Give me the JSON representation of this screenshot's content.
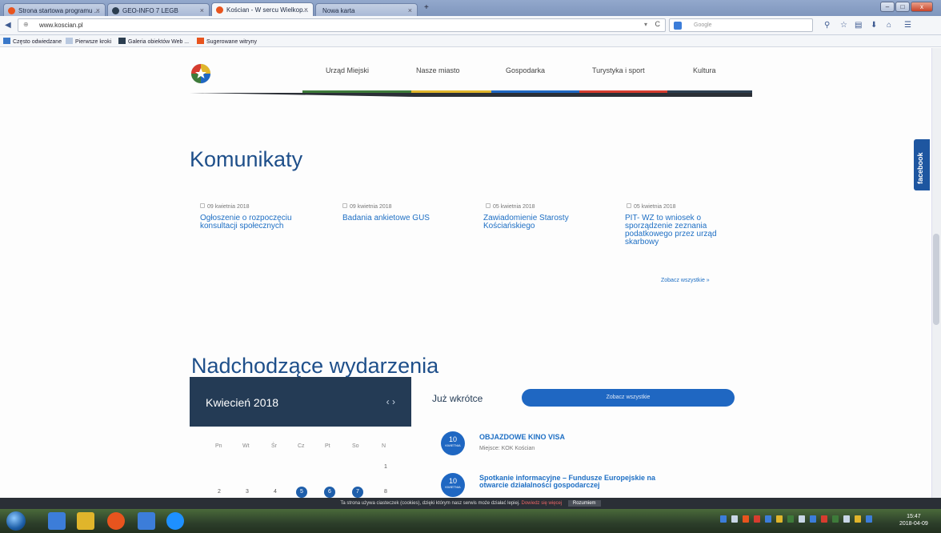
{
  "browser": {
    "tabs": [
      {
        "label": "Strona startowa programu ...",
        "color": "#e8541e"
      },
      {
        "label": "GEO-INFO 7 LEGB",
        "color": "#2c3e50"
      },
      {
        "label": "Kościan - W sercu Wielkop...",
        "color": "#e8541e"
      },
      {
        "label": "Nowa karta",
        "color": ""
      }
    ],
    "new_tab": "+",
    "url": "www.koscian.pl",
    "search_placeholder": "Google",
    "window_buttons": {
      "minimize": "–",
      "maximize": "□",
      "close": "x"
    }
  },
  "bookmarks": [
    {
      "label": "Często odwiedzane",
      "color": "#3a78c9"
    },
    {
      "label": "Pierwsze kroki",
      "color": "#b9c9e0"
    },
    {
      "label": "Galeria obiektów Web ...",
      "color": "#2c3e50"
    },
    {
      "label": "Sugerowane witryny",
      "color": "#e8541e"
    }
  ],
  "site": {
    "menu": [
      "Urząd Miejski",
      "Nasze miasto",
      "Gospodarka",
      "Turystyka i sport",
      "Kultura"
    ],
    "menu_colors": [
      "#3e7b3a",
      "#e0b52b",
      "#1f67c2",
      "#d63c2f",
      "#2c3e50"
    ],
    "news_heading": "Komunikaty",
    "news": [
      {
        "date": "09 kwietnia 2018",
        "title": "Ogłoszenie o rozpoczęciu konsultacji społecznych"
      },
      {
        "date": "09 kwietnia 2018",
        "title": "Badania ankietowe GUS"
      },
      {
        "date": "05 kwietnia 2018",
        "title": "Zawiadomienie Starosty Kościańskiego"
      },
      {
        "date": "05 kwietnia 2018",
        "title": "PIT- WZ to wniosek o sporządzenie zeznania podatkowego przez urząd skarbowy"
      }
    ],
    "see_all": "Zobacz wszystkie »",
    "events_heading": "Nadchodzące wydarzenia",
    "calendar": {
      "month": "Kwiecień 2018",
      "prev": "‹",
      "next": "›",
      "days_of_week": [
        "Pn",
        "Wt",
        "Śr",
        "Cz",
        "Pt",
        "So",
        "N"
      ],
      "row1": [
        "1"
      ],
      "row2": [
        "2",
        "3",
        "4",
        "5",
        "6",
        "7",
        "8"
      ],
      "event_days": [
        "5",
        "6",
        "7"
      ]
    },
    "soon_label": "Już wkrótce",
    "soon_button": "Zobacz wszystkie",
    "events": [
      {
        "day": "10",
        "month": "KWIETNIA",
        "title": "OBJAZDOWE KINO VISA",
        "place": "Miejsce: KOK Kościan"
      },
      {
        "day": "10",
        "month": "KWIETNIA",
        "title": "Spotkanie informacyjne – Fundusze Europejskie na otwarcie działalności gospodarczej",
        "place": ""
      }
    ],
    "facebook": "facebook",
    "cookie_text": "Ta strona używa ciasteczek (cookies), dzięki którym nasz serwis może działać lepiej.",
    "cookie_link": "Dowiedz się więcej",
    "cookie_ok": "Rozumiem"
  },
  "taskbar": {
    "time": "15:47",
    "date": "2018-04-09",
    "app_colors": [
      "#3c7dd9",
      "#e0b52b",
      "#e8541e",
      "#3c7dd9",
      "#1e90ff"
    ],
    "tray_colors": [
      "#3c7dd9",
      "#c9d6e6",
      "#e8541e",
      "#d63c2f",
      "#3c7dd9",
      "#e0b52b",
      "#3e7b3a",
      "#c9d6e6",
      "#3c7dd9",
      "#d63c2f",
      "#3e7b3a",
      "#c9d6e6",
      "#e0b52b",
      "#3c7dd9"
    ]
  }
}
